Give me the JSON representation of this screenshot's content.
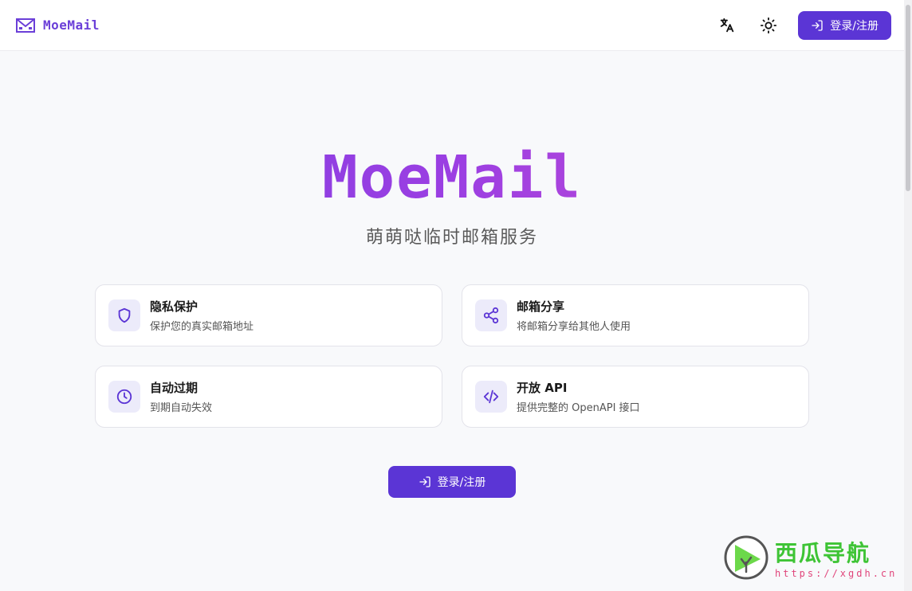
{
  "header": {
    "brand_name": "MoeMail",
    "translate_icon": "translate-icon",
    "theme_icon": "sun-icon",
    "login_label": "登录/注册"
  },
  "hero": {
    "title": "MoeMail",
    "subtitle": "萌萌哒临时邮箱服务"
  },
  "features": [
    {
      "icon": "shield-icon",
      "title": "隐私保护",
      "desc": "保护您的真实邮箱地址"
    },
    {
      "icon": "share-icon",
      "title": "邮箱分享",
      "desc": "将邮箱分享给其他人使用"
    },
    {
      "icon": "clock-icon",
      "title": "自动过期",
      "desc": "到期自动失效"
    },
    {
      "icon": "code-icon",
      "title": "开放 API",
      "desc": "提供完整的 OpenAPI 接口"
    }
  ],
  "cta": {
    "label": "登录/注册",
    "icon": "login-icon"
  },
  "watermark": {
    "title": "西瓜导航",
    "url": "https://xgdh.cn"
  },
  "colors": {
    "accent": "#5b35d5",
    "gradient_start": "#7b3fe0",
    "gradient_end": "#d04fcf"
  }
}
